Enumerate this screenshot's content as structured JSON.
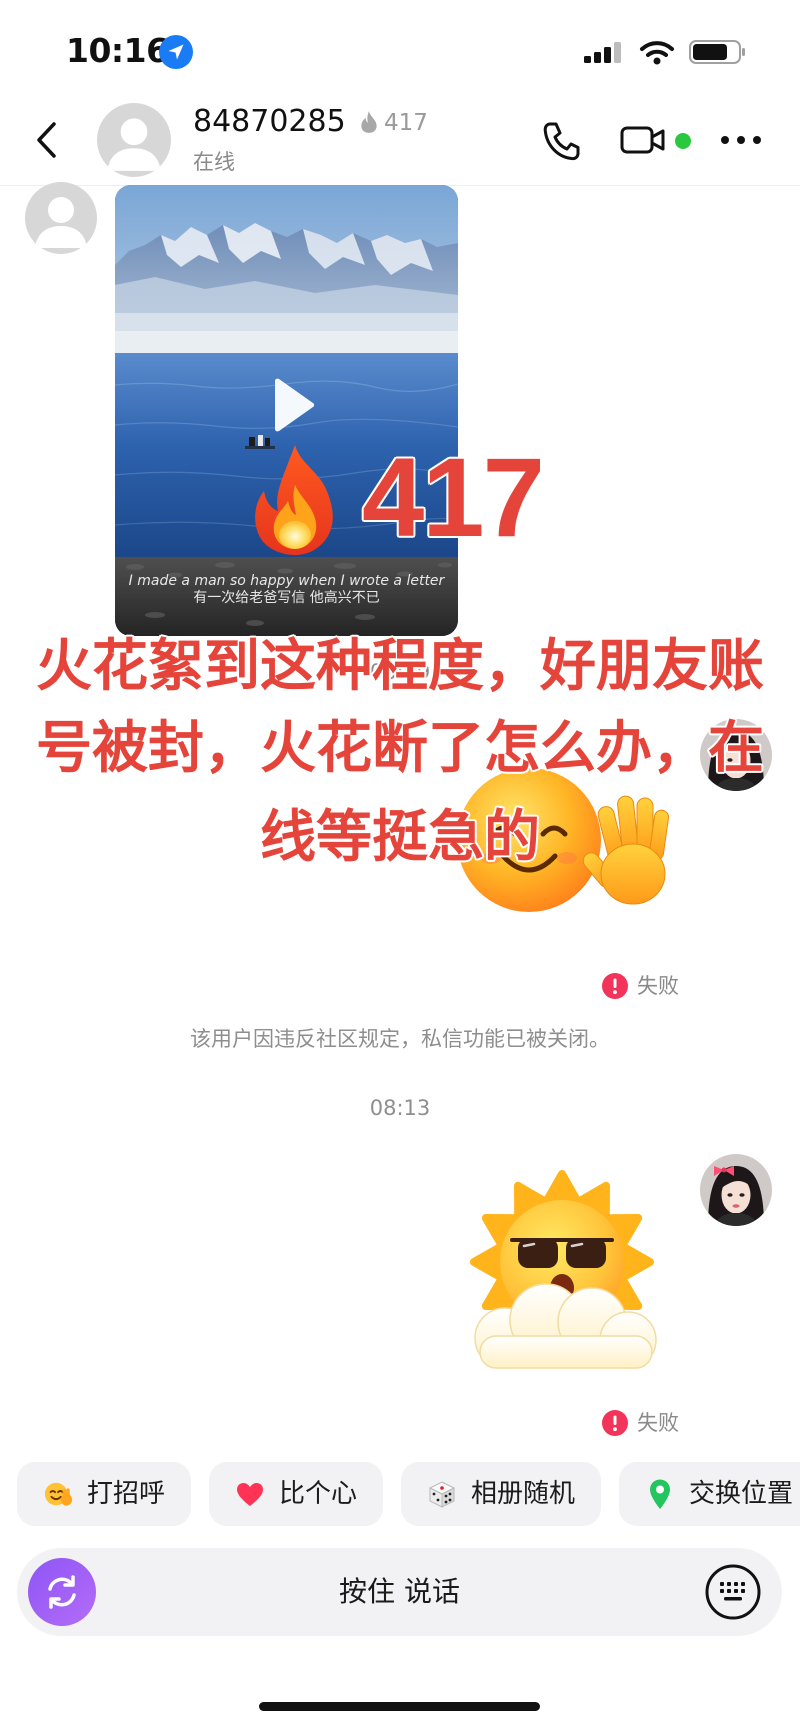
{
  "status_bar": {
    "time": "10:16"
  },
  "header": {
    "name": "84870285",
    "spark_count": "417",
    "status": "在线"
  },
  "video_message": {
    "subtitle_en": "I made a man so happy when I wrote a letter",
    "subtitle_zh": "有一次给老爸写信 他高兴不已"
  },
  "overlay": {
    "spark_count": "417",
    "caption_lines": [
      "火花絮到这种程度，好朋友账",
      "号被封，火花断了怎么办，在",
      "线等挺急的"
    ]
  },
  "messages": {
    "timestamp_1": "08:09",
    "failed_label_1": "失败",
    "system_notice": "该用户因违反社区规定，私信功能已被关闭。",
    "timestamp_2": "08:13",
    "failed_label_2": "失败"
  },
  "quick_actions": [
    {
      "label": "打招呼",
      "icon": "wave-face-icon"
    },
    {
      "label": "比个心",
      "icon": "heart-icon"
    },
    {
      "label": "相册随机",
      "icon": "dice-icon"
    },
    {
      "label": "交换位置",
      "icon": "location-pin-icon"
    }
  ],
  "input_bar": {
    "hold_to_talk_label": "按住 说话"
  },
  "icons": {
    "status": [
      "location-arrow-icon",
      "signal-icon",
      "wifi-icon",
      "battery-icon"
    ],
    "header": [
      "back-chevron-icon",
      "flame-icon",
      "phone-icon",
      "video-camera-icon",
      "more-icon"
    ],
    "chat": [
      "play-icon",
      "fire-emoji",
      "waving-smiley-sticker",
      "sunglasses-sun-sticker",
      "failed-icon"
    ],
    "input": [
      "camera-switch-icon",
      "keyboard-icon"
    ]
  },
  "colors": {
    "overlay_red": "#e5443a",
    "failed_red": "#f2335a",
    "online_green": "#28c840",
    "camera_button_purple": "#9b5cf6",
    "location_blue": "#1a7cf5",
    "chip_background": "#f2f2f4"
  }
}
